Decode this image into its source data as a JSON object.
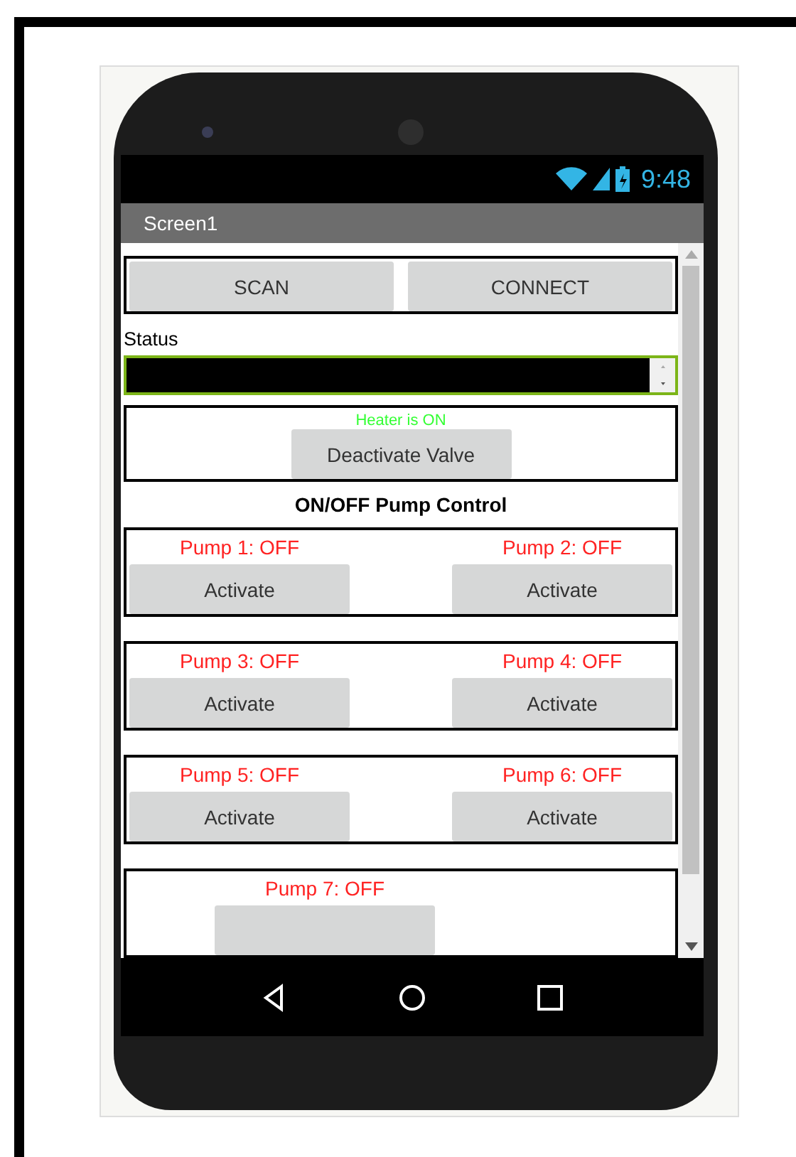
{
  "status_bar": {
    "time": "9:48"
  },
  "title_bar": {
    "title": "Screen1"
  },
  "connection_buttons": [
    "SCAN",
    "CONNECT"
  ],
  "status_label": "Status",
  "heater": {
    "status": "Heater is ON",
    "button": "Deactivate Valve"
  },
  "section_title": "ON/OFF Pump Control",
  "pump_rows": [
    {
      "pumps": [
        {
          "status": "Pump 1: OFF",
          "button": "Activate"
        },
        {
          "status": "Pump 2: OFF",
          "button": "Activate"
        }
      ]
    },
    {
      "pumps": [
        {
          "status": "Pump 3: OFF",
          "button": "Activate"
        },
        {
          "status": "Pump 4: OFF",
          "button": "Activate"
        }
      ]
    },
    {
      "pumps": [
        {
          "status": "Pump 5: OFF",
          "button": "Activate"
        },
        {
          "status": "Pump 6: OFF",
          "button": "Activate"
        }
      ]
    },
    {
      "pumps": [
        {
          "status": "Pump 7: OFF"
        }
      ]
    }
  ]
}
